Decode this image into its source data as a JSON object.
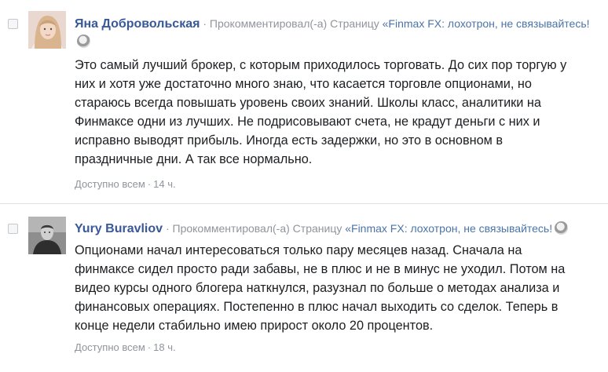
{
  "comments": [
    {
      "author": "Яна Добровольская",
      "separator": "·",
      "action": "Прокомментировал(-а) Страницу",
      "page_link": "«Finmax FX: лохотрон, не связывайтесь!",
      "page_icon": "page-avatar-icon",
      "text": "Это самый лучший брокер, с которым приходилось торговать. До сих пор торгую у\nних и хотя уже достаточно много знаю, что касается торговле опционами, но\nстараюсь всегда повышать уровень своих знаний. Школы класс, аналитики на\nФинмаксе одни из лучших. Не подрисовывают счета, не крадут деньги с них и\nисправно выводят прибыль. Иногда есть задержки, но это в основном в\nпраздничные дни. А так все нормально.",
      "visibility": "Доступно всем",
      "dot": "·",
      "time": "14 ч."
    },
    {
      "author": "Yury Buravliov",
      "separator": "·",
      "action": "Прокомментировал(-а) Страницу",
      "page_link": "«Finmax FX: лохотрон, не связывайтесь!",
      "page_icon": "page-avatar-icon",
      "text": "Опционами начал интересоваться только пару месяцев назад. Сначала на\nфинмаксе сидел просто ради забавы, не в плюс и не в минус не уходил. Потом на\nвидео курсы одного блогера наткнулся, разузнал по больше о методах анализа и\nфинансовых операциях. Постепенно в плюс начал выходить со сделок. Теперь в\nконце недели стабильно имею прирост около 20 процентов.",
      "visibility": "Доступно всем",
      "dot": "·",
      "time": "18 ч."
    }
  ],
  "colors": {
    "author": "#385898",
    "meta": "#90949c",
    "link": "#4b74a8",
    "divider": "#dddfe2"
  }
}
